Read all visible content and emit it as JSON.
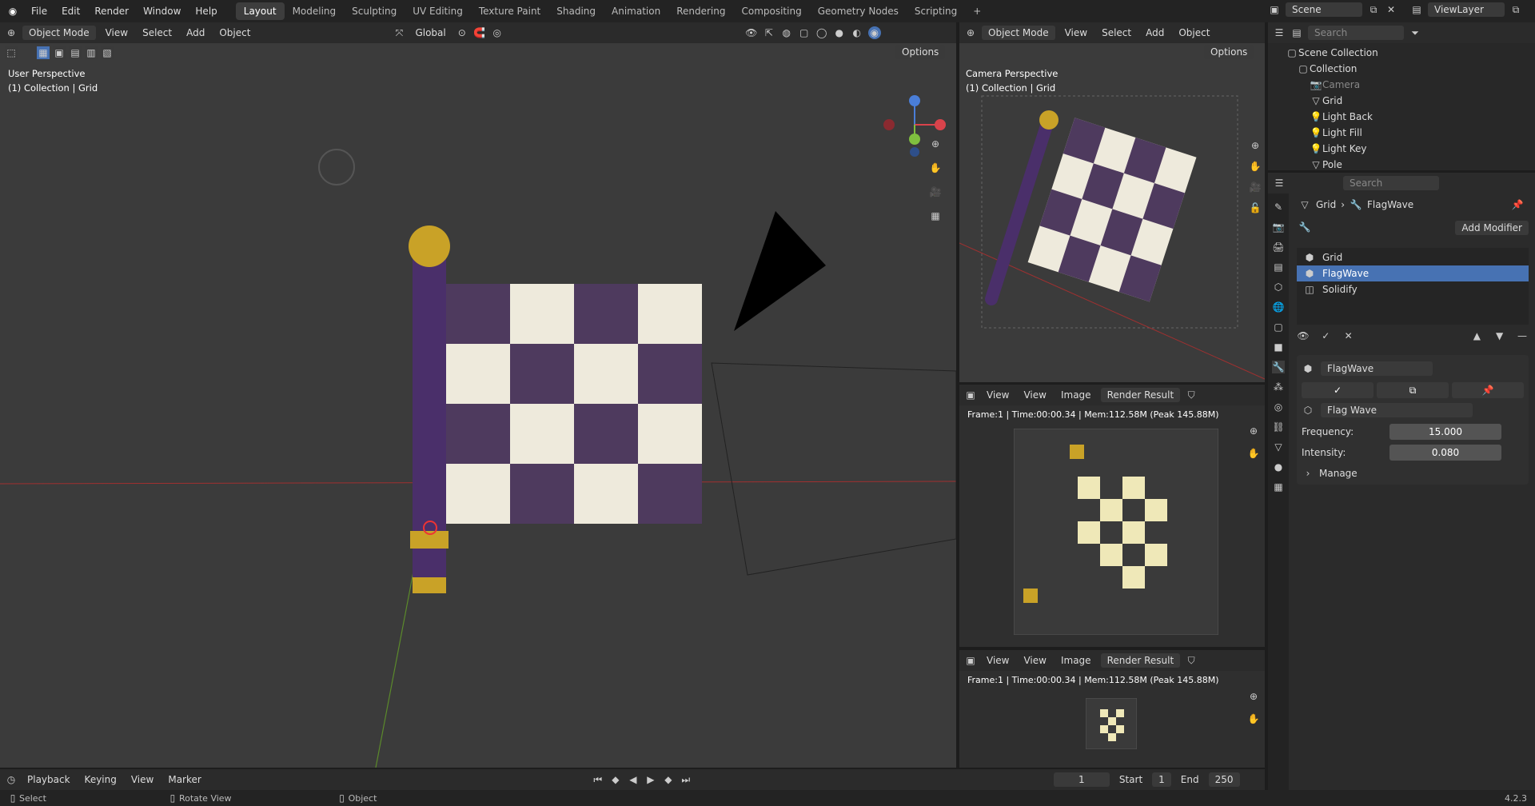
{
  "topbar": {
    "menus": [
      "File",
      "Edit",
      "Render",
      "Window",
      "Help"
    ],
    "workspaces": [
      "Layout",
      "Modeling",
      "Sculpting",
      "UV Editing",
      "Texture Paint",
      "Shading",
      "Animation",
      "Rendering",
      "Compositing",
      "Geometry Nodes",
      "Scripting"
    ],
    "active_workspace": "Layout",
    "add_tab": "+",
    "scene": "Scene",
    "view_layer": "ViewLayer"
  },
  "viewport": {
    "mode": "Object Mode",
    "menus": [
      "View",
      "Select",
      "Add",
      "Object"
    ],
    "transform": "Global",
    "options": "Options",
    "perspective": "User Perspective",
    "collection_line": "(1) Collection | Grid"
  },
  "camera_view": {
    "mode": "Object Mode",
    "menus": [
      "View",
      "Select",
      "Add",
      "Object"
    ],
    "options": "Options",
    "perspective": "Camera Perspective",
    "collection_line": "(1) Collection | Grid"
  },
  "image_editor_1": {
    "view": "View",
    "menus": [
      "View",
      "Image"
    ],
    "image": "Render Result",
    "frame_info": "Frame:1 | Time:00:00.34 | Mem:112.58M (Peak 145.88M)"
  },
  "image_editor_2": {
    "view": "View",
    "menus": [
      "View",
      "Image"
    ],
    "image": "Render Result",
    "frame_info": "Frame:1 | Time:00:00.34 | Mem:112.58M (Peak 145.88M)"
  },
  "outliner": {
    "search_placeholder": "Search",
    "scene_collection": "Scene Collection",
    "collection": "Collection",
    "items": [
      "Camera",
      "Grid",
      "Light Back",
      "Light Fill",
      "Light Key",
      "Pole"
    ]
  },
  "properties": {
    "search_placeholder": "Search",
    "breadcrumb_object": "Grid",
    "breadcrumb_modifier": "FlagWave",
    "add_modifier": "Add Modifier",
    "modifiers": [
      "Grid",
      "FlagWave",
      "Solidify"
    ],
    "selected_modifier": "FlagWave",
    "active_name": "FlagWave",
    "node_group": "Flag Wave",
    "frequency_label": "Frequency:",
    "frequency_value": "15.000",
    "intensity_label": "Intensity:",
    "intensity_value": "0.080",
    "manage": "Manage"
  },
  "timeline": {
    "menus": [
      "Playback",
      "Keying",
      "View",
      "Marker"
    ],
    "current_frame": "1",
    "start_label": "Start",
    "start": "1",
    "end_label": "End",
    "end": "250"
  },
  "statusbar": {
    "select": "Select",
    "rotate": "Rotate View",
    "object": "Object",
    "version": "4.2.3"
  },
  "colors": {
    "accent": "#4772b3",
    "header": "#2b2b2b",
    "viewport": "#3b3b3b"
  }
}
